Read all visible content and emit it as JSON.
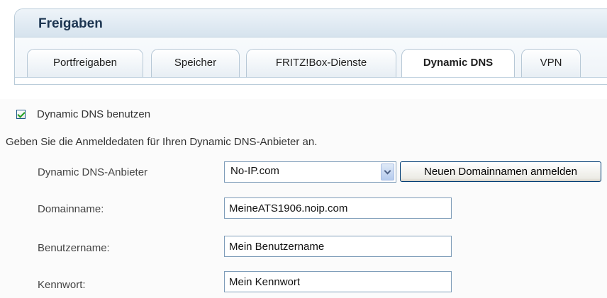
{
  "panel": {
    "title": "Freigaben",
    "tabs": [
      {
        "label": "Portfreigaben",
        "active": false
      },
      {
        "label": "Speicher",
        "active": false
      },
      {
        "label": "FRITZ!Box-Dienste",
        "active": false
      },
      {
        "label": "Dynamic DNS",
        "active": true
      },
      {
        "label": "VPN",
        "active": false
      }
    ]
  },
  "form": {
    "use_dyndns": {
      "label": "Dynamic DNS benutzen",
      "checked": true
    },
    "hint": "Geben Sie die Anmeldedaten für Ihren Dynamic DNS-Anbieter an.",
    "provider": {
      "label": "Dynamic DNS-Anbieter",
      "value": "No-IP.com"
    },
    "register_button": "Neuen Domainnamen anmelden",
    "domain": {
      "label": "Domainname:",
      "value": "MeineATS1906.noip.com"
    },
    "username": {
      "label": "Benutzername:",
      "value": "Mein Benutzername"
    },
    "password": {
      "label": "Kennwort:",
      "value": "Mein Kennwort"
    }
  },
  "colors": {
    "title": "#1c3551",
    "panel_border": "#b9cbd9",
    "checkmark": "#21a121"
  }
}
